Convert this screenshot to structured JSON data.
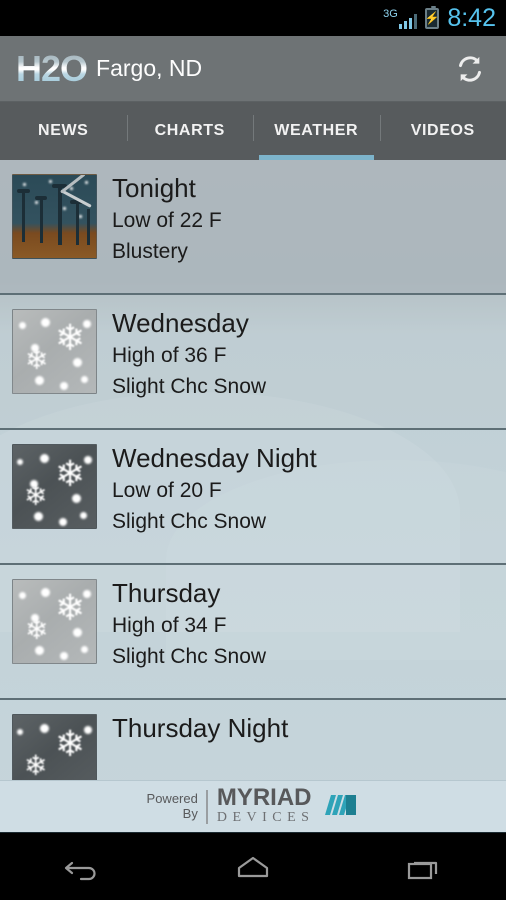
{
  "statusbar": {
    "network_label": "3G",
    "time": "8:42",
    "battery_state": "charging",
    "accent_color": "#56c3ee"
  },
  "actionbar": {
    "logo": "H2O",
    "city": "Fargo, ND",
    "refresh_label": "Refresh",
    "background_color": "#6e7375"
  },
  "tabs": {
    "active_index": 2,
    "indicator_color": "#7db4cb",
    "items": [
      {
        "label": "NEWS"
      },
      {
        "label": "CHARTS"
      },
      {
        "label": "WEATHER"
      },
      {
        "label": "VIDEOS"
      }
    ]
  },
  "forecast": {
    "rows": [
      {
        "period": "Tonight",
        "temperature": "Low of 22 F",
        "condition": "Blustery",
        "icon": "windmill-night-icon"
      },
      {
        "period": "Wednesday",
        "temperature": "High of 36 F",
        "condition": "Slight Chc Snow",
        "icon": "snow-day-icon"
      },
      {
        "period": "Wednesday Night",
        "temperature": "Low of 20 F",
        "condition": "Slight Chc Snow",
        "icon": "snow-night-icon"
      },
      {
        "period": "Thursday",
        "temperature": "High of 34 F",
        "condition": "Slight Chc Snow",
        "icon": "snow-day-icon"
      },
      {
        "period": "Thursday Night",
        "temperature": "",
        "condition": "",
        "icon": "snow-night-icon"
      }
    ]
  },
  "banner": {
    "powered": "Powered",
    "by": "By",
    "brand_primary": "MYRIAD",
    "brand_secondary": "DEVICES",
    "logo_color": "#2ea3b8",
    "background_color": "#cfdde4"
  },
  "navbar": {
    "back_label": "Back",
    "home_label": "Home",
    "recents_label": "Recent apps"
  }
}
